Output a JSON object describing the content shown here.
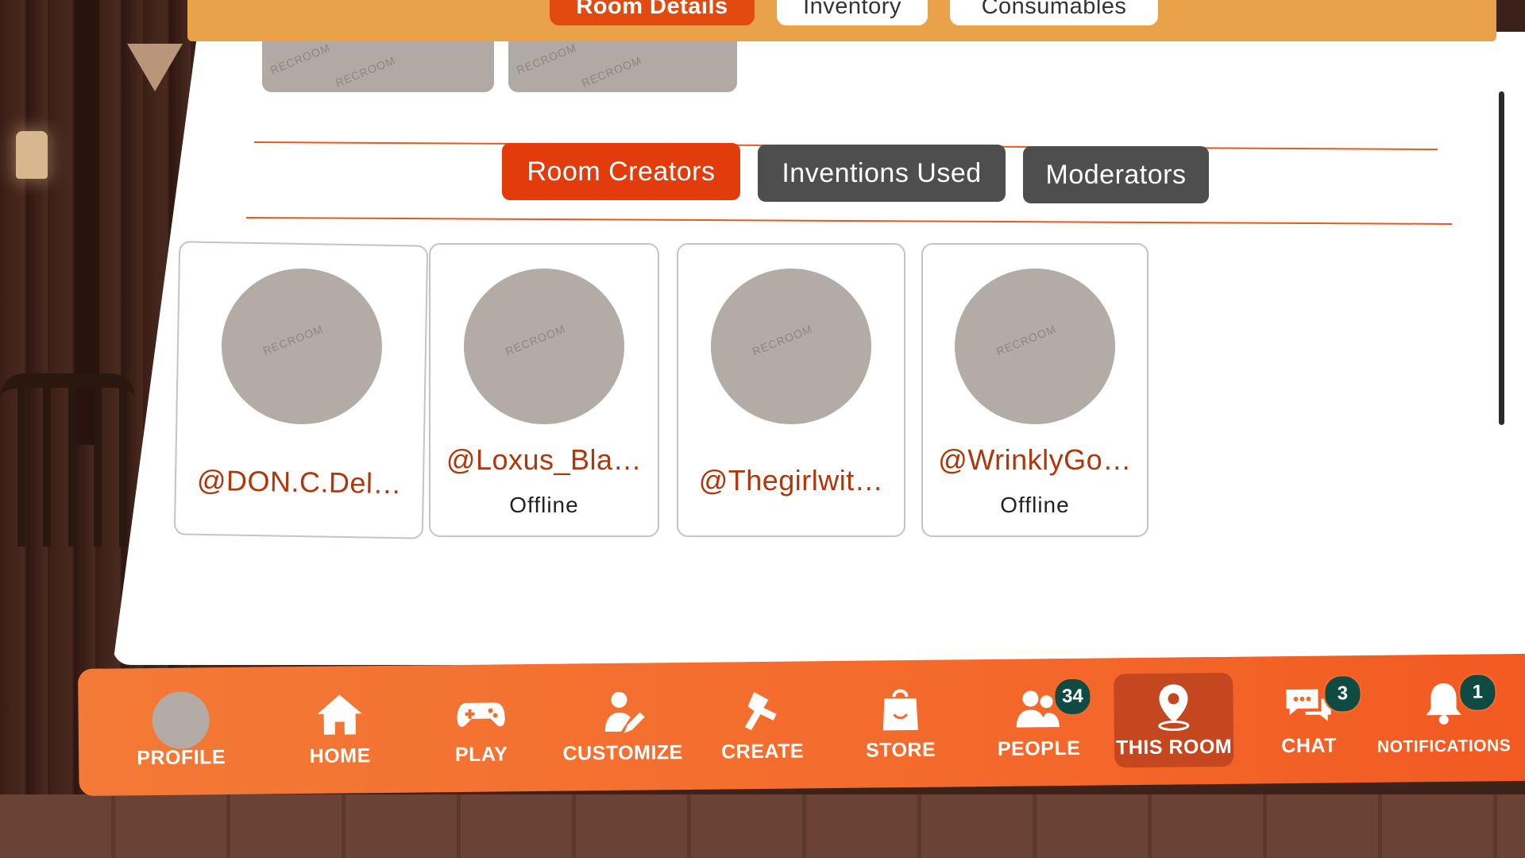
{
  "top_tabs": [
    {
      "label": "Room Details"
    },
    {
      "label": "Inventory"
    },
    {
      "label": "Consumables"
    }
  ],
  "thumbnail_watermark": "RECROOM",
  "sub_tabs": [
    {
      "label": "Room Creators"
    },
    {
      "label": "Inventions Used"
    },
    {
      "label": "Moderators"
    }
  ],
  "creators": [
    {
      "name": "@DON.C.Del…",
      "status": ""
    },
    {
      "name": "@Loxus_Bla…",
      "status": "Offline"
    },
    {
      "name": "@Thegirlwit…",
      "status": ""
    },
    {
      "name": "@WrinklyGo…",
      "status": "Offline"
    }
  ],
  "nav": {
    "profile": {
      "label": "PROFILE",
      "icon": "profile-avatar"
    },
    "home": {
      "label": "HOME",
      "icon": "house-icon"
    },
    "play": {
      "label": "PLAY",
      "icon": "gamepad-icon"
    },
    "customize": {
      "label": "CUSTOMIZE",
      "icon": "person-pencil-icon"
    },
    "create": {
      "label": "CREATE",
      "icon": "maker-pen-icon"
    },
    "store": {
      "label": "STORE",
      "icon": "shopping-bag-icon"
    },
    "people": {
      "label": "PEOPLE",
      "icon": "people-icon",
      "badge": "34"
    },
    "this_room": {
      "label": "THIS ROOM",
      "icon": "location-pin-icon"
    },
    "chat": {
      "label": "CHAT",
      "icon": "chat-bubbles-icon",
      "badge": "3"
    },
    "notifications": {
      "label": "NOTIFICATIONS",
      "icon": "bell-icon",
      "badge": "1"
    }
  },
  "colors": {
    "accent": "#e33c0c",
    "nav_orange": "#f46a2c",
    "creator_name": "#b0360b",
    "badge": "#0f4a43",
    "inactive_tab": "#4e4e4e"
  }
}
